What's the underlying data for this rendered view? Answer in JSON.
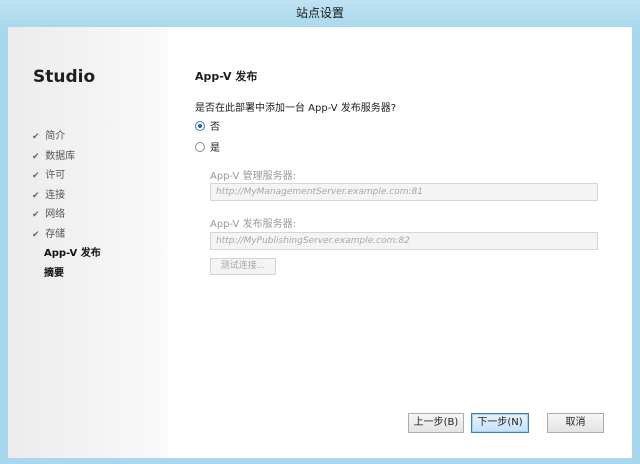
{
  "window": {
    "title": "站点设置"
  },
  "sidebar": {
    "app_title": "Studio",
    "steps": [
      {
        "label": "简介",
        "state": "done"
      },
      {
        "label": "数据库",
        "state": "done"
      },
      {
        "label": "许可",
        "state": "done"
      },
      {
        "label": "连接",
        "state": "done"
      },
      {
        "label": "网络",
        "state": "done"
      },
      {
        "label": "存储",
        "state": "done"
      },
      {
        "label": "App-V 发布",
        "state": "current"
      },
      {
        "label": "摘要",
        "state": "pending"
      }
    ]
  },
  "main": {
    "title": "App-V 发布",
    "question": "是否在此部署中添加一台 App-V 发布服务器?",
    "options": [
      {
        "label": "否",
        "checked": true
      },
      {
        "label": "是",
        "checked": false
      }
    ],
    "management_label": "App-V 管理服务器:",
    "management_placeholder": "http://MyManagementServer.example.com:81",
    "publishing_label": "App-V 发布服务器:",
    "publishing_placeholder": "http://MyPublishingServer.example.com:82",
    "test_button": "测试连接..."
  },
  "footer": {
    "back": "上一步(B)",
    "next": "下一步(N)",
    "cancel": "取消"
  }
}
